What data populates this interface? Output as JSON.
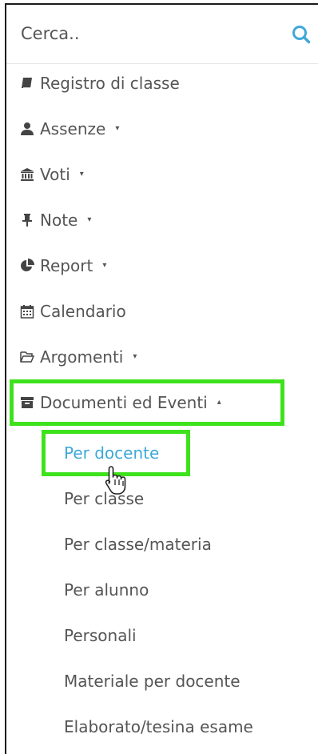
{
  "search": {
    "placeholder": "Cerca.."
  },
  "menu": [
    {
      "label": "Registro di classe",
      "icon": "book-icon",
      "caret": ""
    },
    {
      "label": "Assenze",
      "icon": "user-icon",
      "caret": "▾"
    },
    {
      "label": "Voti",
      "icon": "institution-icon",
      "caret": "▾"
    },
    {
      "label": "Note",
      "icon": "thumbtack-icon",
      "caret": "▾"
    },
    {
      "label": "Report",
      "icon": "pie-chart-icon",
      "caret": "▾"
    },
    {
      "label": "Calendario",
      "icon": "calendar-icon",
      "caret": ""
    },
    {
      "label": "Argomenti",
      "icon": "folder-open-icon",
      "caret": "▾"
    },
    {
      "label": "Documenti ed Eventi",
      "icon": "archive-icon",
      "caret": "▴"
    }
  ],
  "submenu": [
    {
      "label": "Per docente",
      "active": true
    },
    {
      "label": "Per classe"
    },
    {
      "label": "Per classe/materia"
    },
    {
      "label": "Per alunno"
    },
    {
      "label": "Personali"
    },
    {
      "label": "Materiale per docente"
    },
    {
      "label": "Elaborato/tesina esame"
    }
  ],
  "colors": {
    "accent": "#3fa9d8",
    "highlight": "#3ee21c",
    "text": "#555555"
  }
}
